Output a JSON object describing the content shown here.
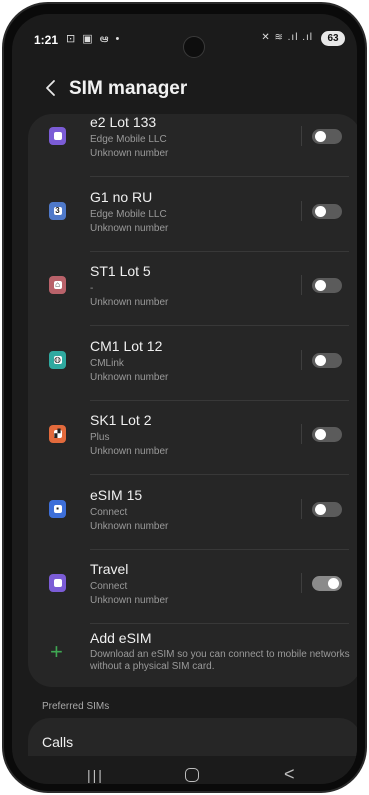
{
  "status_bar": {
    "time": "1:21",
    "left_icons": "⊡ ▣ ఆ •",
    "right_icons": "✕ ≋ .ıl .ıl",
    "battery": "63"
  },
  "header": {
    "title": "SIM manager"
  },
  "sims": [
    {
      "name": "e2 Lot 133",
      "carrier": "Edge Mobile LLC",
      "number": "Unknown number",
      "icon_color": "#7b5cd6",
      "glyph": "",
      "on": false
    },
    {
      "name": "G1 no RU",
      "carrier": "Edge Mobile LLC",
      "number": "Unknown number",
      "icon_color": "#4f79c9",
      "glyph": "3",
      "on": false
    },
    {
      "name": "ST1 Lot 5",
      "carrier": "-",
      "number": "Unknown number",
      "icon_color": "#b9626a",
      "glyph": "⌂",
      "on": false
    },
    {
      "name": "CM1 Lot 12",
      "carrier": "CMLink",
      "number": "Unknown number",
      "icon_color": "#2fa9a0",
      "glyph": "◍",
      "on": false
    },
    {
      "name": "SK1 Lot 2",
      "carrier": "Plus",
      "number": "Unknown number",
      "icon_color": "#e26a3c",
      "glyph": "▞",
      "on": false
    },
    {
      "name": "eSIM 15",
      "carrier": "Connect",
      "number": "Unknown number",
      "icon_color": "#3d6fd9",
      "glyph": "▪",
      "on": false
    },
    {
      "name": "Travel",
      "carrier": "Connect",
      "number": "Unknown number",
      "icon_color": "#7b5cd6",
      "glyph": "",
      "on": true
    }
  ],
  "add_esim": {
    "title": "Add eSIM",
    "description": "Download an eSIM so you can connect to mobile networks without a physical SIM card."
  },
  "preferred": {
    "label": "Preferred SIMs",
    "calls": "Calls"
  },
  "nav": {
    "recent": "|||",
    "back": "<"
  }
}
